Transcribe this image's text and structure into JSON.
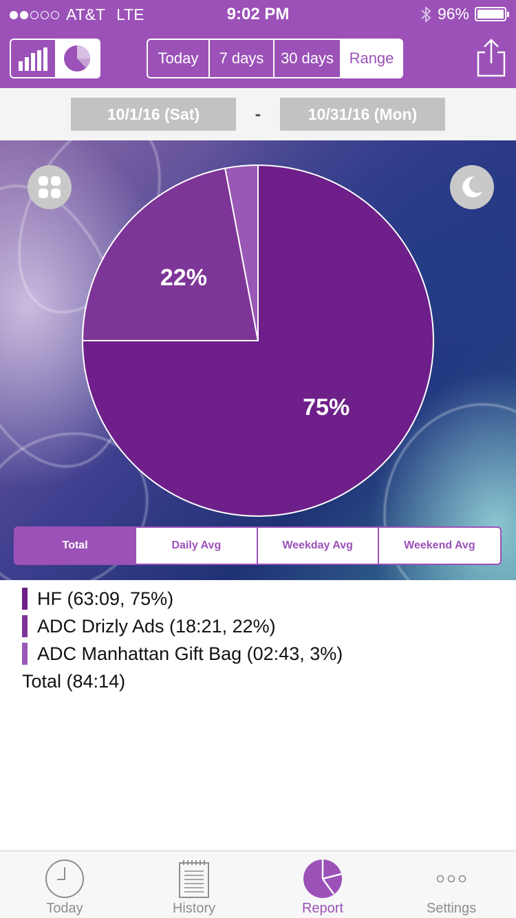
{
  "status_bar": {
    "carrier": "AT&T",
    "network": "LTE",
    "time": "9:02 PM",
    "battery": "96%",
    "signal_bars_filled": 2,
    "signal_bars_total": 5
  },
  "toolbar": {
    "view_toggle": [
      {
        "icon": "bar-chart-icon",
        "active": false
      },
      {
        "icon": "pie-chart-icon",
        "active": true
      }
    ],
    "range_tabs": [
      {
        "label": "Today",
        "active": false
      },
      {
        "label": "7 days",
        "active": false
      },
      {
        "label": "30 days",
        "active": false
      },
      {
        "label": "Range",
        "active": true
      }
    ],
    "share_icon": "share-icon"
  },
  "date_range": {
    "start": "10/1/16 (Sat)",
    "separator": "-",
    "end": "10/31/16 (Mon)"
  },
  "chart_data": {
    "type": "pie",
    "title": "",
    "slices": [
      {
        "label": "HF",
        "value": 75,
        "display": "75%",
        "color": "#6e1f8a"
      },
      {
        "label": "ADC  Drizly Ads",
        "value": 22,
        "display": "22%",
        "color": "#7e3598"
      },
      {
        "label": "ADC Manhattan Gift Bag",
        "value": 3,
        "display": "",
        "color": "#9a58b6"
      }
    ]
  },
  "chart_buttons": {
    "left_icon": "grid-icon",
    "right_icon": "moon-icon"
  },
  "stat_tabs": [
    {
      "label": "Total",
      "active": true
    },
    {
      "label": "Daily Avg",
      "active": false
    },
    {
      "label": "Weekday Avg",
      "active": false
    },
    {
      "label": "Weekend Avg",
      "active": false
    }
  ],
  "legend": {
    "items": [
      {
        "text": "HF (63:09, 75%)",
        "color": "#6e1f8a"
      },
      {
        "text": "ADC  Drizly Ads (18:21, 22%)",
        "color": "#7e3598"
      },
      {
        "text": "ADC Manhattan Gift Bag (02:43, 3%)",
        "color": "#9a58b6"
      }
    ],
    "total": "Total (84:14)"
  },
  "tab_bar": [
    {
      "label": "Today",
      "icon": "clock-icon",
      "active": false
    },
    {
      "label": "History",
      "icon": "notepad-icon",
      "active": false
    },
    {
      "label": "Report",
      "icon": "pie-chart-icon",
      "active": true
    },
    {
      "label": "Settings",
      "icon": "more-icon",
      "active": false
    }
  ],
  "colors": {
    "accent": "#9b51b8",
    "date_box": "#c2c2c2"
  }
}
